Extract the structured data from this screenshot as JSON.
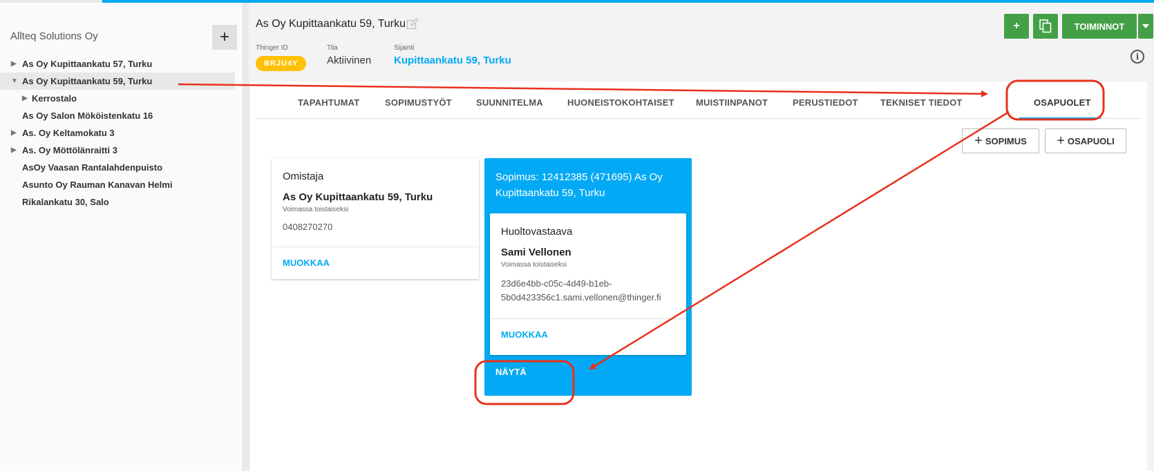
{
  "sidebar": {
    "org_name": "Allteq Solutions Oy",
    "add_label": "+",
    "items": [
      {
        "label": "As Oy Kupittaankatu 57, Turku",
        "arrow": "▶"
      },
      {
        "label": "As Oy Kupittaankatu 59, Turku",
        "arrow": "▼"
      },
      {
        "label": "Kerrostalo",
        "arrow": "▶"
      },
      {
        "label": "As Oy Salon Mököistenkatu 16",
        "arrow": ""
      },
      {
        "label": "As. Oy Keltamokatu 3",
        "arrow": "▶"
      },
      {
        "label": "As. Oy Möttölänraitti 3",
        "arrow": "▶"
      },
      {
        "label": "AsOy Vaasan Rantalahdenpuisto",
        "arrow": ""
      },
      {
        "label": "Asunto Oy Rauman Kanavan Helmi",
        "arrow": ""
      },
      {
        "label": "Rikalankatu 30, Salo",
        "arrow": ""
      }
    ]
  },
  "header": {
    "title": "As Oy Kupittaankatu 59, Turku",
    "thinger_id_label": "Thinger ID",
    "thinger_id": "BRJU4Y",
    "status_label": "Tila",
    "status": "Aktiivinen",
    "location_label": "Sijainti",
    "location": "Kupittaankatu 59, Turku",
    "add_button": "+",
    "actions_button": "TOIMINNOT",
    "info_icon": "i"
  },
  "tabs": [
    "TAPAHTUMAT",
    "SOPIMUSTYÖT",
    "SUUNNITELMA",
    "HUONEISTOKOHTAISET",
    "MUISTIINPANOT",
    "PERUSTIEDOT",
    "TEKNISET TIEDOT",
    "OSAPUOLET"
  ],
  "active_tab": "OSAPUOLET",
  "buttons": {
    "add_contract": "SOPIMUS",
    "add_party": "OSAPUOLI",
    "plus": "+"
  },
  "owner_card": {
    "role": "Omistaja",
    "name": "As Oy Kupittaankatu 59, Turku",
    "validity": "Voimassa toistaiseksi",
    "contact": "0408270270",
    "action": "MUOKKAA"
  },
  "contract_card": {
    "title": "Sopimus: 12412385 (471695) As Oy Kupittaankatu 59, Turku",
    "show_action": "NÄYTÄ",
    "party": {
      "role": "Huoltovastaava",
      "name": "Sami Vellonen",
      "validity": "Voimassa toistaiseksi",
      "contact_line1": "23d6e4bb-c05c-4d49-b1eb-",
      "contact_line2": "5b0d423356c1.sami.vellonen@thinger.fi",
      "action": "MUOKKAA"
    }
  },
  "colors": {
    "accent": "#03a9f4",
    "green": "#43a047",
    "badge": "#ffc107",
    "annotation": "#e8301c"
  }
}
